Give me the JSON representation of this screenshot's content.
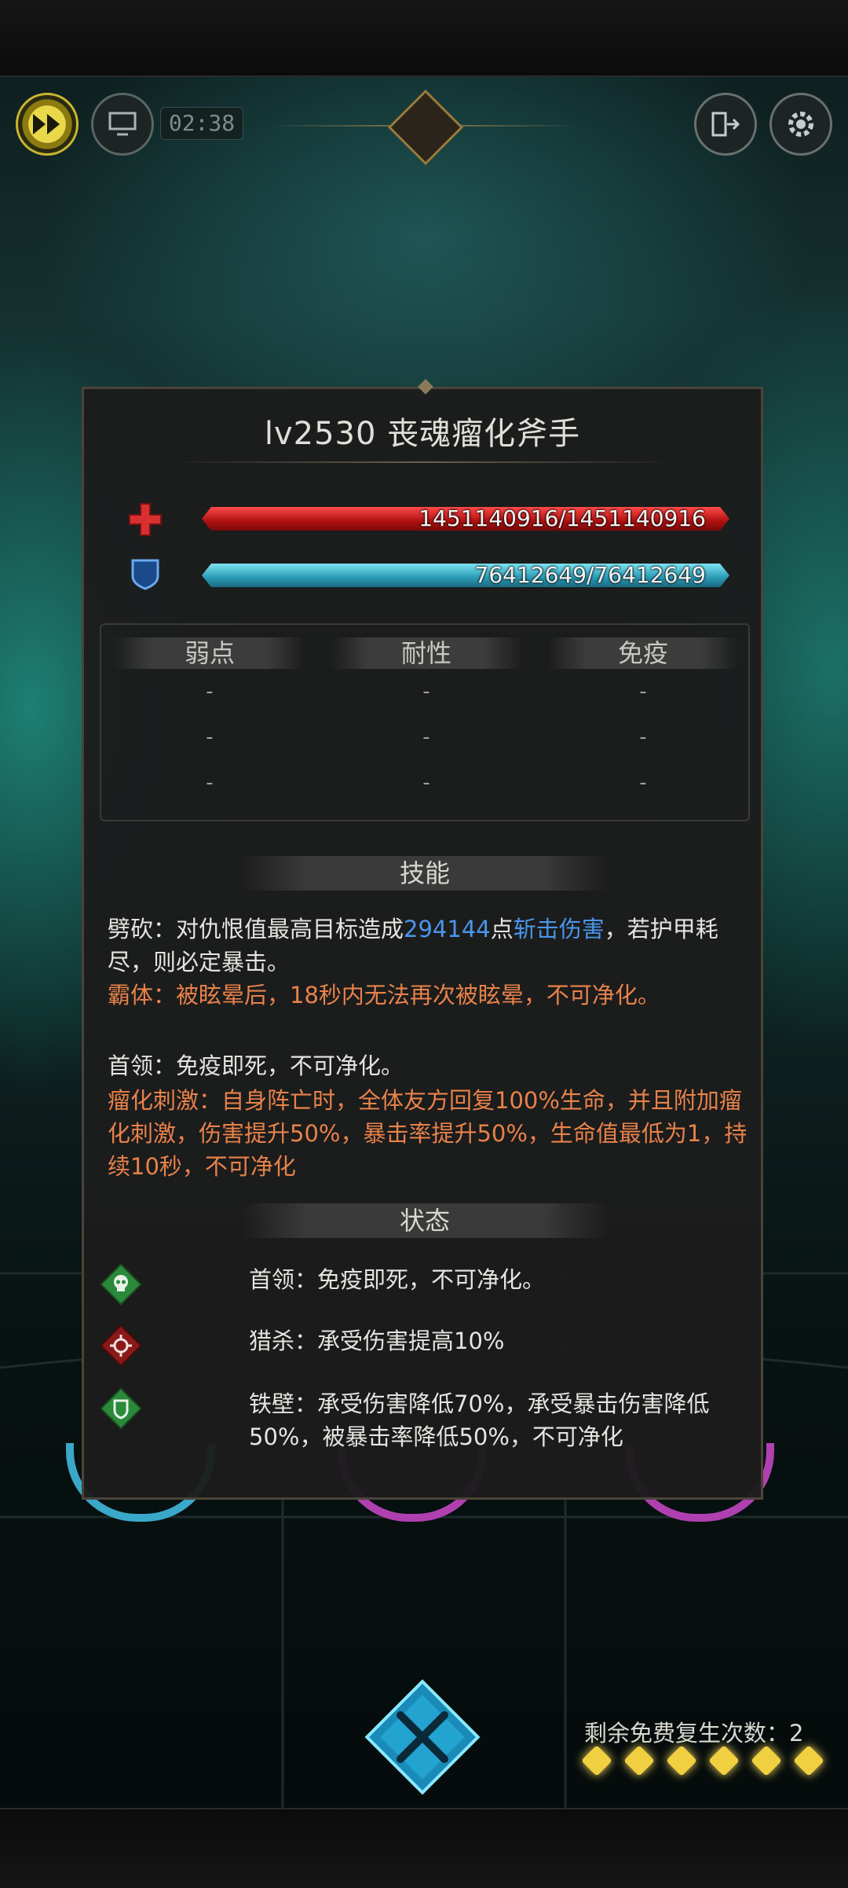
{
  "hud": {
    "timer": "02:38"
  },
  "enemy": {
    "title": "lv2530  丧魂瘤化斧手",
    "hp_text": "1451140916/1451140916",
    "hp_fraction": 1.0,
    "shield_text": "76412649/76412649",
    "shield_fraction": 1.0
  },
  "resistances": {
    "columns": [
      {
        "label": "弱点",
        "values": [
          "-",
          "-",
          "-"
        ]
      },
      {
        "label": "耐性",
        "values": [
          "-",
          "-",
          "-"
        ]
      },
      {
        "label": "免疫",
        "values": [
          "-",
          "-",
          "-"
        ]
      }
    ]
  },
  "skills": {
    "header": "技能",
    "s1_prefix": "劈砍：对仇恨值最高目标造成",
    "s1_number": "294144",
    "s1_mid": "点",
    "s1_dmg": "斩击伤害",
    "s1_suffix": "，若护甲耗尽，则必定暴击。",
    "s2": "霸体：被眩晕后，18秒内无法再次被眩晕，不可净化。",
    "s3": "首领：免疫即死，不可净化。",
    "s4": "瘤化刺激：自身阵亡时，全体友方回复100%生命，并且附加瘤化刺激，伤害提升50%，暴击率提升50%，生命值最低为1，持续10秒，不可净化"
  },
  "status": {
    "header": "状态",
    "items": [
      {
        "icon": "skull-icon",
        "text": "首领：免疫即死，不可净化。"
      },
      {
        "icon": "hunt-mark-icon",
        "text": "猎杀：承受伤害提高10%"
      },
      {
        "icon": "iron-wall-icon",
        "text": "铁壁：承受伤害降低70%，承受暴击伤害降低50%，被暴击率降低50%，不可净化"
      }
    ]
  },
  "footer": {
    "revive_text": "剩余免费复生次数：2",
    "energy_dots": 6
  },
  "colors": {
    "hp": "#c81a1a",
    "shield": "#3ab4cc",
    "skill_orange": "#e8824a",
    "damage_blue": "#4a96ec",
    "status_green": "#2a8a3a",
    "status_red": "#8a1a1a"
  }
}
